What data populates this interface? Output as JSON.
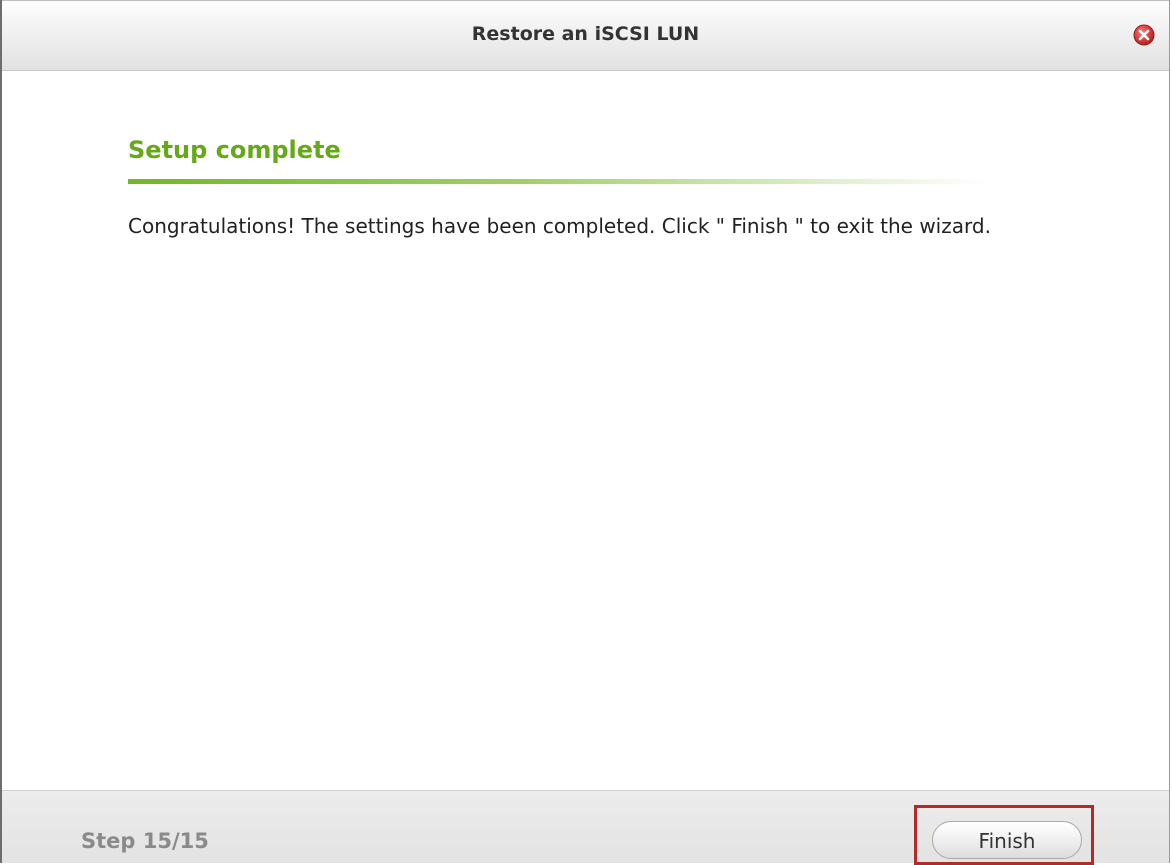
{
  "window": {
    "title": "Restore an iSCSI LUN",
    "close_icon": "close-icon"
  },
  "content": {
    "section_title": "Setup complete",
    "message": "Congratulations! The settings have been completed. Click \" Finish \" to exit the wizard."
  },
  "footer": {
    "step": "Step 15/15",
    "finish_label": "Finish"
  },
  "colors": {
    "accent_green": "#65a818",
    "highlight_red": "#b22a2a",
    "close_red": "#d93a3a"
  }
}
